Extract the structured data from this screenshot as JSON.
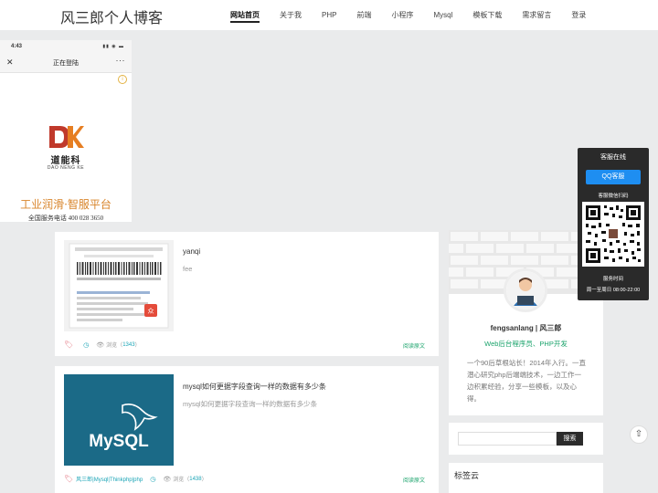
{
  "header": {
    "brand": "风三郎个人博客",
    "nav": [
      "网站首页",
      "关于我",
      "PHP",
      "前端",
      "小程序",
      "Mysql",
      "模板下载",
      "需求留言",
      "登录"
    ]
  },
  "ad": {
    "status_time": "4:43",
    "header_title": "正在登陆",
    "info_icon": "info-icon",
    "brand": "道能科",
    "brand_en": "DAO NENG KE",
    "slogan": "工业润滑·智服平台",
    "phone": "全国服务电话 400 028 3650"
  },
  "articles": [
    {
      "title": "yanqi",
      "desc": "fee",
      "tags": "",
      "views_label": "浏览",
      "views": "1343",
      "read_more": "阅读原文"
    },
    {
      "title": "mysql如何更据字段查询一样的数据有多少条",
      "desc": "mysql如何更据字段查询一样的数据有多少条",
      "tags": "风三郎|Mysql|Thinkphp|php",
      "views_label": "浏览",
      "views": "1438",
      "read_more": "阅读原文",
      "thumb_text": "MySQL"
    }
  ],
  "profile": {
    "name": "fengsanlang | 风三郎",
    "role": "Web后台程序员、PHP开发",
    "bio": "一个90后草根站长！2014年入行。一直潜心研究php后端端技术，一边工作一边积累经验，分享一些模板，以及心得。"
  },
  "search": {
    "button": "搜索",
    "placeholder": ""
  },
  "tags": {
    "title": "标签云"
  },
  "customer_service": {
    "title": "客服在线",
    "qq": "QQ客服",
    "wechat": "客服微信扫码",
    "hours_label": "服务时间",
    "hours": "周一至周日 08:00-22:00"
  },
  "back_to_top": "⇧",
  "colors": {
    "accent_green": "#1aa36b",
    "accent_teal": "#1aa4b6",
    "qq_blue": "#1e8ef1",
    "mysql_bg": "#1b6a87"
  }
}
